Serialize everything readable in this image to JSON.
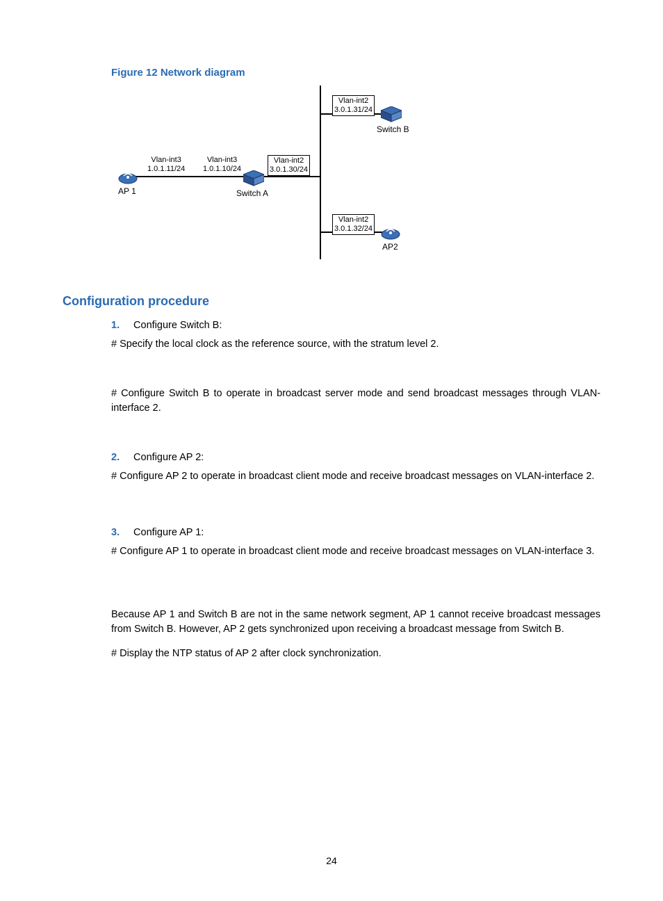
{
  "figure": {
    "caption": "Figure 12 Network diagram",
    "nodes": {
      "ap1": "AP 1",
      "switchA": "Switch A",
      "switchB": "Switch B",
      "ap2": "AP2"
    },
    "labels": {
      "ap1_int": {
        "l1": "Vlan-int3",
        "l2": "1.0.1.11/24"
      },
      "swA_left": {
        "l1": "Vlan-int3",
        "l2": "1.0.1.10/24"
      },
      "swA_right": {
        "l1": "Vlan-int2",
        "l2": "3.0.1.30/24"
      },
      "swB": {
        "l1": "Vlan-int2",
        "l2": "3.0.1.31/24"
      },
      "ap2": {
        "l1": "Vlan-int2",
        "l2": "3.0.1.32/24"
      }
    }
  },
  "section_heading": "Configuration procedure",
  "steps": [
    {
      "num": "1.",
      "title": "Configure Switch B:",
      "lines": [
        "# Specify the local clock as the reference source, with the stratum level 2.",
        "# Configure Switch B to operate in broadcast server mode and send broadcast messages through VLAN-interface 2."
      ]
    },
    {
      "num": "2.",
      "title": "Configure AP 2:",
      "lines": [
        "# Configure AP 2 to operate in broadcast client mode and receive broadcast messages on VLAN-interface 2."
      ]
    },
    {
      "num": "3.",
      "title": "Configure AP 1:",
      "lines": [
        "# Configure AP 1 to operate in broadcast client mode and receive broadcast messages on VLAN-interface 3."
      ]
    }
  ],
  "tail": [
    "Because AP 1 and Switch B are not in the same network segment, AP 1 cannot receive broadcast messages from Switch B. However, AP 2 gets synchronized upon receiving a broadcast message from Switch B.",
    "# Display the NTP status of AP 2 after clock synchronization."
  ],
  "page_number": "24"
}
